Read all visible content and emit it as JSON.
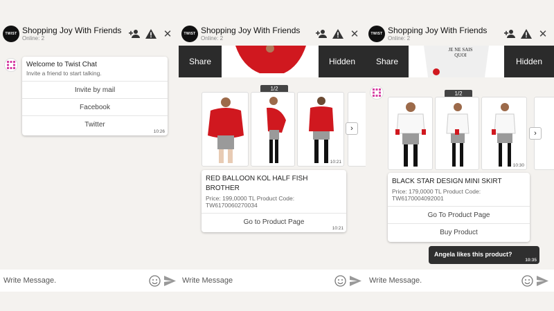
{
  "header": {
    "title": "Shopping Joy With Friends",
    "subtitle": "Online: 2",
    "logo_text": "TWIST"
  },
  "welcome": {
    "title": "Welcome to Twist Chat",
    "subtitle": "Invite a friend to start talking.",
    "options": [
      "Invite by mail",
      "Facebook",
      "Twitter"
    ],
    "time": "10:26"
  },
  "footer": {
    "placeholder_dot": "Write Message.",
    "placeholder": "Write Message"
  },
  "share_bar": {
    "share_label": "Share",
    "hidden_label": "Hidden"
  },
  "product1": {
    "counter": "1/2",
    "image_time": "10:21",
    "name": "RED BALLOON KOL HALF FISH BROTHER",
    "info": "Price: 199,0000 TL Product Code: TW6170060270034",
    "button": "Go to Product Page",
    "time": "10:21"
  },
  "product2": {
    "counter": "1/2",
    "image_time": "10:30",
    "name": "BLACK STAR DESIGN MINI SKIRT",
    "info": "Price: 179,0000 TL Product Code: TW6170004092001",
    "button1": "Go To Product Page",
    "button2": "Buy Product"
  },
  "like_message": {
    "text": "Angela likes this product?",
    "time": "10:35"
  },
  "shirt_print": "JE NE SAIS QUOI",
  "colors": {
    "dark": "#2b2b2b",
    "red": "#d0181f",
    "background": "#f4f2ef"
  },
  "icons": [
    "add-user-icon",
    "warning-icon",
    "close-icon",
    "emoji-icon",
    "send-icon",
    "chevron-right-icon"
  ]
}
